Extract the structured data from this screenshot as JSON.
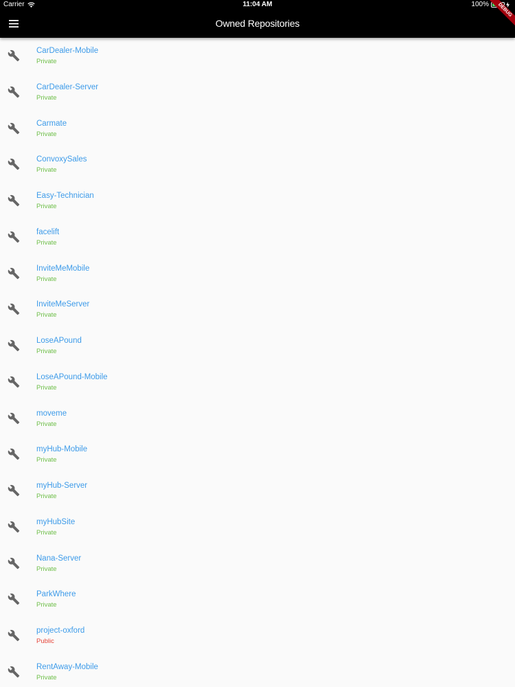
{
  "status_bar": {
    "carrier": "Carrier",
    "time": "11:04 AM",
    "battery": "100%",
    "battery_level": 1.0
  },
  "app_bar": {
    "title": "Owned Repositories",
    "debug_label": "DEBUG"
  },
  "colors": {
    "link": "#3d9be9",
    "private": "#6fbf4a",
    "public": "#e5453a"
  },
  "repositories": [
    {
      "name": "CarDealer-Mobile",
      "visibility": "Private"
    },
    {
      "name": "CarDealer-Server",
      "visibility": "Private"
    },
    {
      "name": "Carmate",
      "visibility": "Private"
    },
    {
      "name": "ConvoxySales",
      "visibility": "Private"
    },
    {
      "name": "Easy-Technician",
      "visibility": "Private"
    },
    {
      "name": "facelift",
      "visibility": "Private"
    },
    {
      "name": "InviteMeMobile",
      "visibility": "Private"
    },
    {
      "name": "InviteMeServer",
      "visibility": "Private"
    },
    {
      "name": "LoseAPound",
      "visibility": "Private"
    },
    {
      "name": "LoseAPound-Mobile",
      "visibility": "Private"
    },
    {
      "name": "moveme",
      "visibility": "Private"
    },
    {
      "name": "myHub-Mobile",
      "visibility": "Private"
    },
    {
      "name": "myHub-Server",
      "visibility": "Private"
    },
    {
      "name": "myHubSite",
      "visibility": "Private"
    },
    {
      "name": "Nana-Server",
      "visibility": "Private"
    },
    {
      "name": "ParkWhere",
      "visibility": "Private"
    },
    {
      "name": "project-oxford",
      "visibility": "Public"
    },
    {
      "name": "RentAway-Mobile",
      "visibility": "Private"
    }
  ]
}
